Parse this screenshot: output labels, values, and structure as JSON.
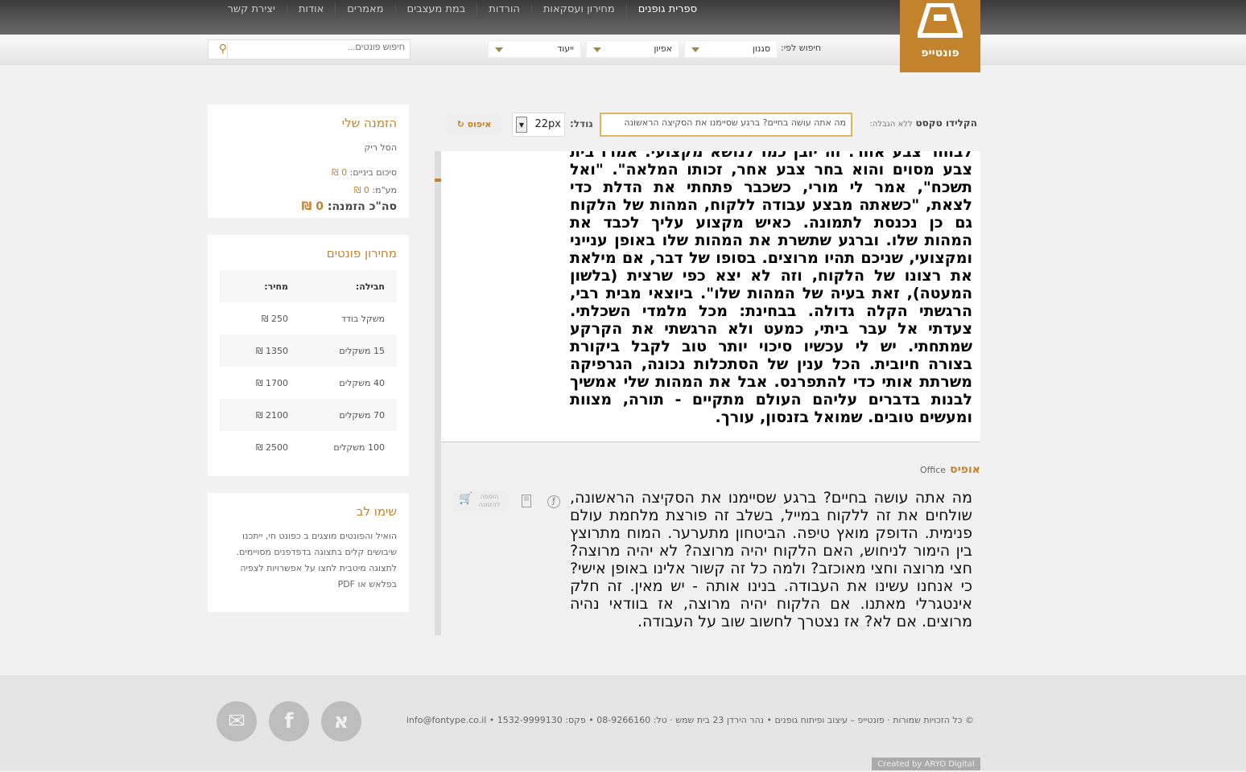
{
  "nav": [
    "ספרית גופנים",
    "מחירון ועסקאות",
    "הורדות",
    "במת מעצבים",
    "מאמרים",
    "אודות",
    "יצירת קשר"
  ],
  "logo": {
    "name": "פונטייפ"
  },
  "filters": {
    "label": "חיפוש לפי:",
    "style": "סגנון",
    "character": "אפיון",
    "purpose": "ייעוד"
  },
  "search": {
    "placeholder": "חיפוש פונטים..."
  },
  "toolbar": {
    "type_label": "הקלידו טקסט",
    "no_limit": "ללא הגבלה:",
    "text_value": "מה אתה עושה בחיים? ברגע שסיימנו את הסקיצה הראשונה",
    "size_label": "גודל:",
    "size_value": "22px",
    "reset": "איפוס"
  },
  "preview1": {
    "text": "לבחור צבע אחר. זה יובן כמו לנושא מקצועי. אמרו בית צבע מסוים והוא בחר צבע אחר, זכותו המלאה\". \"ואל תשכח\", אמר לי מורי, כשכבר פתחתי את הדלת כדי לצאת, \"כשאתה מבצע עבודה ללקוח, המהות של הלקוח גם כן נכנסת לתמונה. כאיש מקצוע עליך לכבד את המהות שלו. וברגע שתשרת את המהות שלו באופן ענייני ומקצועי, שניכם תהיו מרוצים. בסופו של דבר, אם מילאת את רצונו של הלקוח, וזה לא יצא כפי שרצית (בלשון המעטה), זאת בעיה של המהות שלו\". ביוצאי מבית רבי, הרגשתי הקלה גדולה. בבחינת: מכל מלמדי השכלתי. צעדתי אל עבר ביתי, כמעט ולא הרגשתי את הקרקע שמתחתי. יש לי עכשיו סיכוי יותר טוב לקבל ביקורת בצורה חיובית. הכל ענין של הסתכלות נכונה, הגרפיקה משרתת אותי כדי להתפרנס. אבל את המהות שלי אמשיך לבנות בדברים עליהם העולם מתקיים - תורה, מצוות ומעשים טובים. שמואל בזנסון, עורך."
  },
  "font2": {
    "name": "אופיס",
    "latin": "Office",
    "add_label": "הוספה להזמנה",
    "text": "מה אתה עושה בחיים? ברגע שסיימנו את הסקיצה הראשונה, שולחים את זה ללקוח במייל, בשלב זה פורצת מלחמת עולם פנימית. הדופק מואץ טיפה. הביטחון מתערער. המוח מתרוצץ בין הימור לניחוש, האם הלקוח יהיה מרוצה? לא יהיה מרוצה? חצי מרוצה וחצי מאוכזב? ולמה כל זה קשור אלינו באופן אישי? כי אנחנו עשינו את העבודה. בנינו אותה - יש מאין. זה חלק אינטגרלי מאתנו. אם הלקוח יהיה מרוצה, אז בוודאי נהיה מרוצים. אם לא? אז נצטרך לחשוב שוב על העבודה."
  },
  "order": {
    "title": "הזמנה שלי",
    "empty": "הסל ריק",
    "subtotal": "סיכום ביניים: ",
    "vat": "מע\"מ: ",
    "total": "סה\"כ הזמנה: ",
    "subtotal_val": "0 ₪",
    "vat_val": "0 ₪",
    "total_val": "0 ₪"
  },
  "pricing": {
    "title": "מחירון פונטים",
    "col_pkg": "חבילה:",
    "col_price": "מחיר:",
    "rows": [
      {
        "pkg": "משקל בודד",
        "price": "250 ₪"
      },
      {
        "pkg": "15 משקלים",
        "price": "1350 ₪"
      },
      {
        "pkg": "40 משקלים",
        "price": "1700 ₪"
      },
      {
        "pkg": "70 משקלים",
        "price": "2100 ₪"
      },
      {
        "pkg": "100 משקלים",
        "price": "2500 ₪"
      }
    ]
  },
  "notice": {
    "title": "שימו לב",
    "text": "הואיל והפונטים מוצגים ב כפונט חי, ייתכנו שיבושים קלים בתצוגה בדפדפנים מסויימים. לתצוגה מיטבית לחצו על אפשרויות לצפיה בפלאש או PDF"
  },
  "footer": {
    "text": "© כל הזכויות שמורות · פונטייפ – עיצוב ופיתוח גופנים • נהר הירדן 23 בית שמש · טל: 08-9266160 • פקס: 1532-9999130 • info@fontype.co.il",
    "credit": "Created by ARYO Digital"
  },
  "social": {
    "mail": "✉",
    "facebook": "f",
    "aleph": "א"
  }
}
